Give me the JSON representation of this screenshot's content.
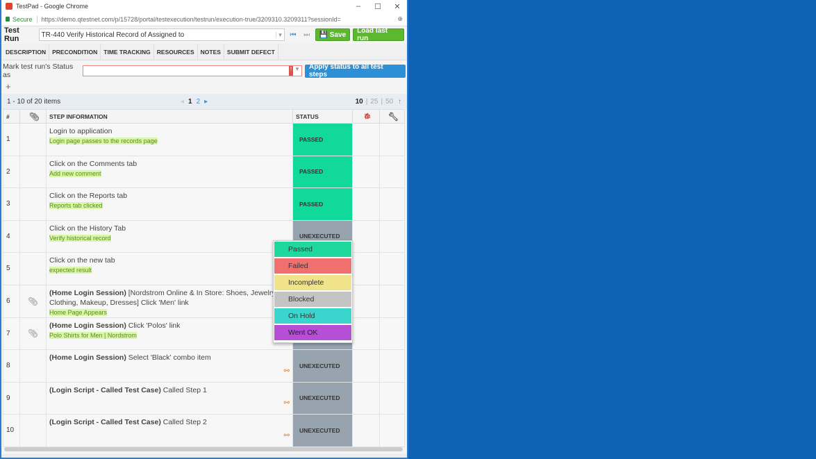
{
  "window": {
    "title": "TestPad - Google Chrome",
    "secure": "Secure",
    "url": "https://demo.qtestnet.com/p/15728/portal/testexecution/testrun/execution-true/3209310.3209311?sessionId="
  },
  "toolbar": {
    "label": "Test Run",
    "test_run": "TR-440 Verify Historical Record of Assigned to",
    "save": "Save",
    "load_last_run": "Load last run"
  },
  "tabs": [
    "DESCRIPTION",
    "PRECONDITION",
    "TIME TRACKING",
    "RESOURCES",
    "NOTES",
    "SUBMIT DEFECT"
  ],
  "status_row": {
    "label": "Mark test run's Status as",
    "value": "",
    "apply": "Apply status to all test steps"
  },
  "pager": {
    "summary": "1 - 10 of 20 items",
    "pages": [
      "1",
      "2"
    ],
    "current": "1",
    "sizes": [
      "10",
      "25",
      "50"
    ],
    "size_current": "10"
  },
  "columns": {
    "num": "#",
    "step": "STEP INFORMATION",
    "status": "STATUS"
  },
  "rows": [
    {
      "n": "1",
      "prefix": "",
      "desc": "Login to application",
      "expected": "Login page passes to the records page",
      "status": "PASSED",
      "attach": false,
      "called": false
    },
    {
      "n": "2",
      "prefix": "",
      "desc": "Click on the Comments tab",
      "expected": "Add new comment",
      "status": "PASSED",
      "attach": false,
      "called": false
    },
    {
      "n": "3",
      "prefix": "",
      "desc": "Click on the Reports tab",
      "expected": "Reports tab clicked",
      "status": "PASSED",
      "attach": false,
      "called": false
    },
    {
      "n": "4",
      "prefix": "",
      "desc": "Click on the History Tab",
      "expected": "Verify historical record",
      "status": "UNEXECUTED",
      "attach": false,
      "called": false
    },
    {
      "n": "5",
      "prefix": "",
      "desc": "Click on the new tab",
      "expected": "expected result",
      "status": "",
      "attach": false,
      "called": false
    },
    {
      "n": "6",
      "prefix": "(Home Login Session)",
      "desc": " [Nordstrom Online & In Store: Shoes, Jewelry, Clothing, Makeup, Dresses] Click 'Men' link",
      "expected": "Home Page Appears",
      "status": "",
      "attach": true,
      "called": false
    },
    {
      "n": "7",
      "prefix": "(Home Login Session)",
      "desc": " Click 'Polos' link",
      "expected": "Polo Shirts for Men | Nordstrom",
      "status": "",
      "attach": true,
      "called": false
    },
    {
      "n": "8",
      "prefix": "(Home Login Session)",
      "desc": " Select 'Black' combo item",
      "expected": "",
      "status": "UNEXECUTED",
      "attach": false,
      "called": true
    },
    {
      "n": "9",
      "prefix": "(Login Script - Called Test Case)",
      "desc": " Called Step 1",
      "expected": "",
      "status": "UNEXECUTED",
      "attach": false,
      "called": true
    },
    {
      "n": "10",
      "prefix": "(Login Script - Called Test Case)",
      "desc": " Called Step 2",
      "expected": "",
      "status": "UNEXECUTED",
      "attach": false,
      "called": true
    }
  ],
  "dropdown": [
    {
      "label": "Passed",
      "color": "#1ed99b"
    },
    {
      "label": "Failed",
      "color": "#f07070"
    },
    {
      "label": "Incomplete",
      "color": "#f0e38a"
    },
    {
      "label": "Blocked",
      "color": "#c4c4c4"
    },
    {
      "label": "On Hold",
      "color": "#3ad5cc"
    },
    {
      "label": "Went OK",
      "color": "#b44fd6"
    }
  ]
}
